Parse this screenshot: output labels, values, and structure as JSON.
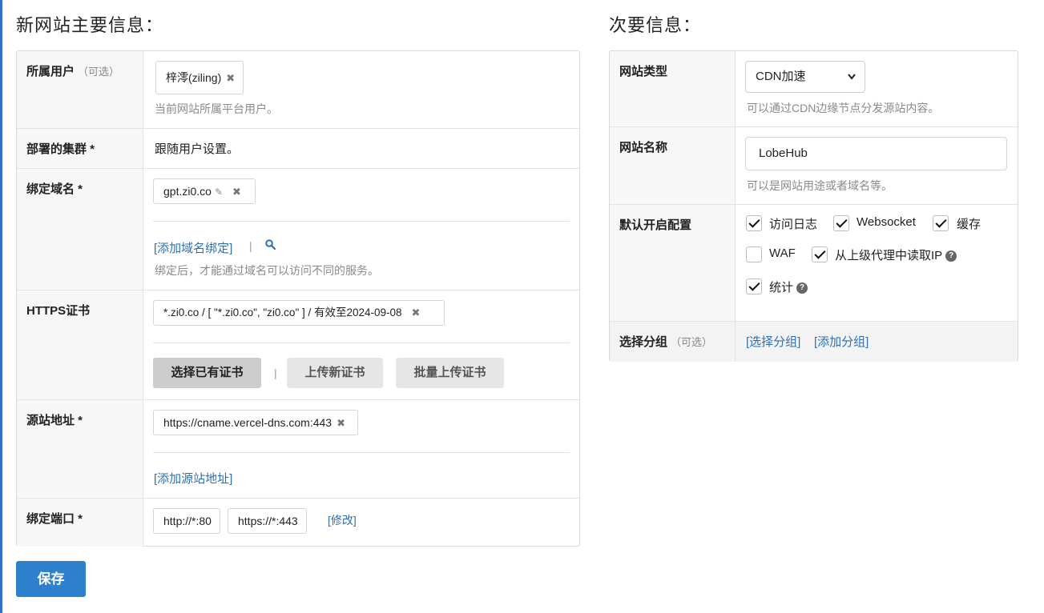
{
  "primary": {
    "title": "新网站主要信息：",
    "user": {
      "label": "所属用户",
      "optional": "（可选）",
      "tag": "梓澪(ziling)",
      "hint": "当前网站所属平台用户。"
    },
    "cluster": {
      "label": "部署的集群 *",
      "value": "跟随用户设置。"
    },
    "domain": {
      "label": "绑定域名 *",
      "tag": "gpt.zi0.co",
      "add_link": "[添加域名绑定]",
      "sep": "|",
      "hint": "绑定后，才能通过域名可以访问不同的服务。"
    },
    "https": {
      "label": "HTTPS证书",
      "cert": "*.zi0.co / [ \"*.zi0.co\", \"zi0.co\" ] / 有效至2024-09-08",
      "btn_select": "选择已有证书",
      "sep": "|",
      "btn_upload": "上传新证书",
      "btn_batch": "批量上传证书"
    },
    "origin": {
      "label": "源站地址 *",
      "tag": "https://cname.vercel-dns.com:443",
      "add_link": "[添加源站地址]"
    },
    "port": {
      "label": "绑定端口 *",
      "http": "http://*:80",
      "https": "https://*:443",
      "edit_link": "[修改]"
    },
    "save_label": "保存"
  },
  "secondary": {
    "title": "次要信息：",
    "type": {
      "label": "网站类型",
      "selected": "CDN加速",
      "hint": "可以通过CDN边缘节点分发源站内容。"
    },
    "name": {
      "label": "网站名称",
      "value": "LobeHub",
      "hint": "可以是网站用途或者域名等。"
    },
    "defaults": {
      "label": "默认开启配置",
      "options": [
        {
          "label": "访问日志",
          "checked": true
        },
        {
          "label": "Websocket",
          "checked": true
        },
        {
          "label": "缓存",
          "checked": true
        },
        {
          "label": "WAF",
          "checked": false
        },
        {
          "label": "从上级代理中读取IP",
          "checked": true
        },
        {
          "label": "统计",
          "checked": true
        }
      ]
    },
    "group": {
      "label": "选择分组",
      "optional": "（可选）",
      "select_link": "[选择分组]",
      "add_link": "[添加分组]"
    }
  }
}
